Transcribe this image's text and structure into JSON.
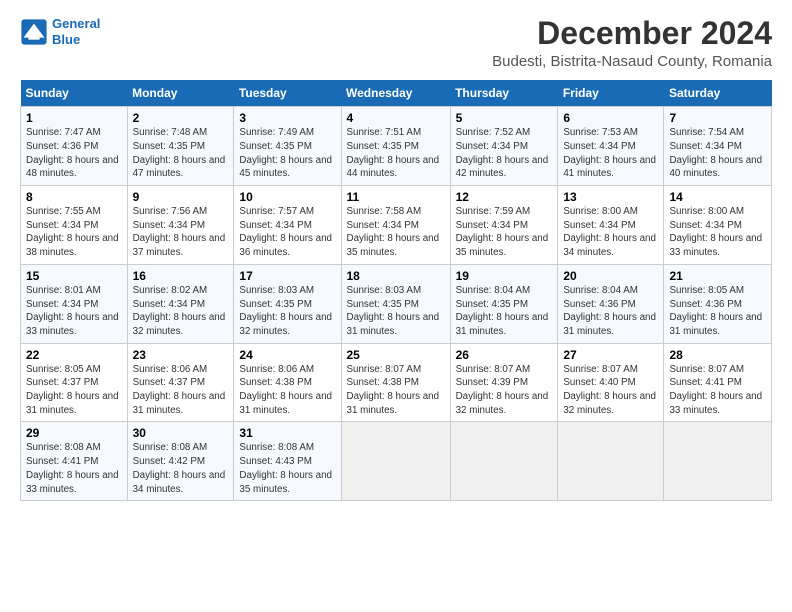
{
  "logo": {
    "line1": "General",
    "line2": "Blue"
  },
  "title": "December 2024",
  "subtitle": "Budesti, Bistrita-Nasaud County, Romania",
  "headers": [
    "Sunday",
    "Monday",
    "Tuesday",
    "Wednesday",
    "Thursday",
    "Friday",
    "Saturday"
  ],
  "weeks": [
    [
      {
        "day": "1",
        "sunrise": "Sunrise: 7:47 AM",
        "sunset": "Sunset: 4:36 PM",
        "daylight": "Daylight: 8 hours and 48 minutes."
      },
      {
        "day": "2",
        "sunrise": "Sunrise: 7:48 AM",
        "sunset": "Sunset: 4:35 PM",
        "daylight": "Daylight: 8 hours and 47 minutes."
      },
      {
        "day": "3",
        "sunrise": "Sunrise: 7:49 AM",
        "sunset": "Sunset: 4:35 PM",
        "daylight": "Daylight: 8 hours and 45 minutes."
      },
      {
        "day": "4",
        "sunrise": "Sunrise: 7:51 AM",
        "sunset": "Sunset: 4:35 PM",
        "daylight": "Daylight: 8 hours and 44 minutes."
      },
      {
        "day": "5",
        "sunrise": "Sunrise: 7:52 AM",
        "sunset": "Sunset: 4:34 PM",
        "daylight": "Daylight: 8 hours and 42 minutes."
      },
      {
        "day": "6",
        "sunrise": "Sunrise: 7:53 AM",
        "sunset": "Sunset: 4:34 PM",
        "daylight": "Daylight: 8 hours and 41 minutes."
      },
      {
        "day": "7",
        "sunrise": "Sunrise: 7:54 AM",
        "sunset": "Sunset: 4:34 PM",
        "daylight": "Daylight: 8 hours and 40 minutes."
      }
    ],
    [
      {
        "day": "8",
        "sunrise": "Sunrise: 7:55 AM",
        "sunset": "Sunset: 4:34 PM",
        "daylight": "Daylight: 8 hours and 38 minutes."
      },
      {
        "day": "9",
        "sunrise": "Sunrise: 7:56 AM",
        "sunset": "Sunset: 4:34 PM",
        "daylight": "Daylight: 8 hours and 37 minutes."
      },
      {
        "day": "10",
        "sunrise": "Sunrise: 7:57 AM",
        "sunset": "Sunset: 4:34 PM",
        "daylight": "Daylight: 8 hours and 36 minutes."
      },
      {
        "day": "11",
        "sunrise": "Sunrise: 7:58 AM",
        "sunset": "Sunset: 4:34 PM",
        "daylight": "Daylight: 8 hours and 35 minutes."
      },
      {
        "day": "12",
        "sunrise": "Sunrise: 7:59 AM",
        "sunset": "Sunset: 4:34 PM",
        "daylight": "Daylight: 8 hours and 35 minutes."
      },
      {
        "day": "13",
        "sunrise": "Sunrise: 8:00 AM",
        "sunset": "Sunset: 4:34 PM",
        "daylight": "Daylight: 8 hours and 34 minutes."
      },
      {
        "day": "14",
        "sunrise": "Sunrise: 8:00 AM",
        "sunset": "Sunset: 4:34 PM",
        "daylight": "Daylight: 8 hours and 33 minutes."
      }
    ],
    [
      {
        "day": "15",
        "sunrise": "Sunrise: 8:01 AM",
        "sunset": "Sunset: 4:34 PM",
        "daylight": "Daylight: 8 hours and 33 minutes."
      },
      {
        "day": "16",
        "sunrise": "Sunrise: 8:02 AM",
        "sunset": "Sunset: 4:34 PM",
        "daylight": "Daylight: 8 hours and 32 minutes."
      },
      {
        "day": "17",
        "sunrise": "Sunrise: 8:03 AM",
        "sunset": "Sunset: 4:35 PM",
        "daylight": "Daylight: 8 hours and 32 minutes."
      },
      {
        "day": "18",
        "sunrise": "Sunrise: 8:03 AM",
        "sunset": "Sunset: 4:35 PM",
        "daylight": "Daylight: 8 hours and 31 minutes."
      },
      {
        "day": "19",
        "sunrise": "Sunrise: 8:04 AM",
        "sunset": "Sunset: 4:35 PM",
        "daylight": "Daylight: 8 hours and 31 minutes."
      },
      {
        "day": "20",
        "sunrise": "Sunrise: 8:04 AM",
        "sunset": "Sunset: 4:36 PM",
        "daylight": "Daylight: 8 hours and 31 minutes."
      },
      {
        "day": "21",
        "sunrise": "Sunrise: 8:05 AM",
        "sunset": "Sunset: 4:36 PM",
        "daylight": "Daylight: 8 hours and 31 minutes."
      }
    ],
    [
      {
        "day": "22",
        "sunrise": "Sunrise: 8:05 AM",
        "sunset": "Sunset: 4:37 PM",
        "daylight": "Daylight: 8 hours and 31 minutes."
      },
      {
        "day": "23",
        "sunrise": "Sunrise: 8:06 AM",
        "sunset": "Sunset: 4:37 PM",
        "daylight": "Daylight: 8 hours and 31 minutes."
      },
      {
        "day": "24",
        "sunrise": "Sunrise: 8:06 AM",
        "sunset": "Sunset: 4:38 PM",
        "daylight": "Daylight: 8 hours and 31 minutes."
      },
      {
        "day": "25",
        "sunrise": "Sunrise: 8:07 AM",
        "sunset": "Sunset: 4:38 PM",
        "daylight": "Daylight: 8 hours and 31 minutes."
      },
      {
        "day": "26",
        "sunrise": "Sunrise: 8:07 AM",
        "sunset": "Sunset: 4:39 PM",
        "daylight": "Daylight: 8 hours and 32 minutes."
      },
      {
        "day": "27",
        "sunrise": "Sunrise: 8:07 AM",
        "sunset": "Sunset: 4:40 PM",
        "daylight": "Daylight: 8 hours and 32 minutes."
      },
      {
        "day": "28",
        "sunrise": "Sunrise: 8:07 AM",
        "sunset": "Sunset: 4:41 PM",
        "daylight": "Daylight: 8 hours and 33 minutes."
      }
    ],
    [
      {
        "day": "29",
        "sunrise": "Sunrise: 8:08 AM",
        "sunset": "Sunset: 4:41 PM",
        "daylight": "Daylight: 8 hours and 33 minutes."
      },
      {
        "day": "30",
        "sunrise": "Sunrise: 8:08 AM",
        "sunset": "Sunset: 4:42 PM",
        "daylight": "Daylight: 8 hours and 34 minutes."
      },
      {
        "day": "31",
        "sunrise": "Sunrise: 8:08 AM",
        "sunset": "Sunset: 4:43 PM",
        "daylight": "Daylight: 8 hours and 35 minutes."
      },
      null,
      null,
      null,
      null
    ]
  ]
}
